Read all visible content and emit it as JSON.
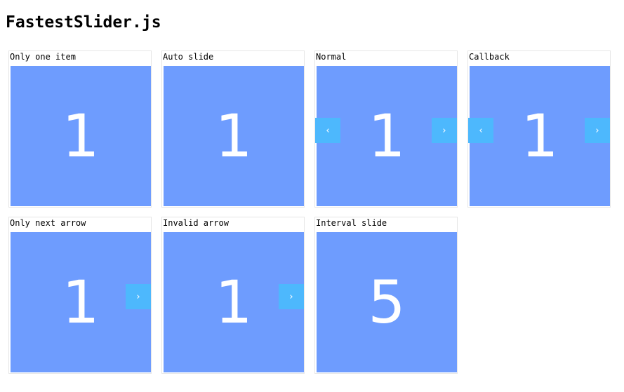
{
  "title": "FastestSlider.js",
  "arrows": {
    "prev": "‹",
    "next": "›"
  },
  "demos": [
    {
      "label": "Only one item",
      "number": "1"
    },
    {
      "label": "Auto slide",
      "number": "1"
    },
    {
      "label": "Normal",
      "number": "1"
    },
    {
      "label": "Callback",
      "number": "1"
    },
    {
      "label": "Only next arrow",
      "number": "1"
    },
    {
      "label": "Invalid arrow",
      "number": "1"
    },
    {
      "label": "Interval slide",
      "number": "5"
    }
  ],
  "colors": {
    "slide_bg": "#6e9cfe",
    "arrow_bg": "#4db8fd",
    "slide_text": "#ffffff"
  }
}
